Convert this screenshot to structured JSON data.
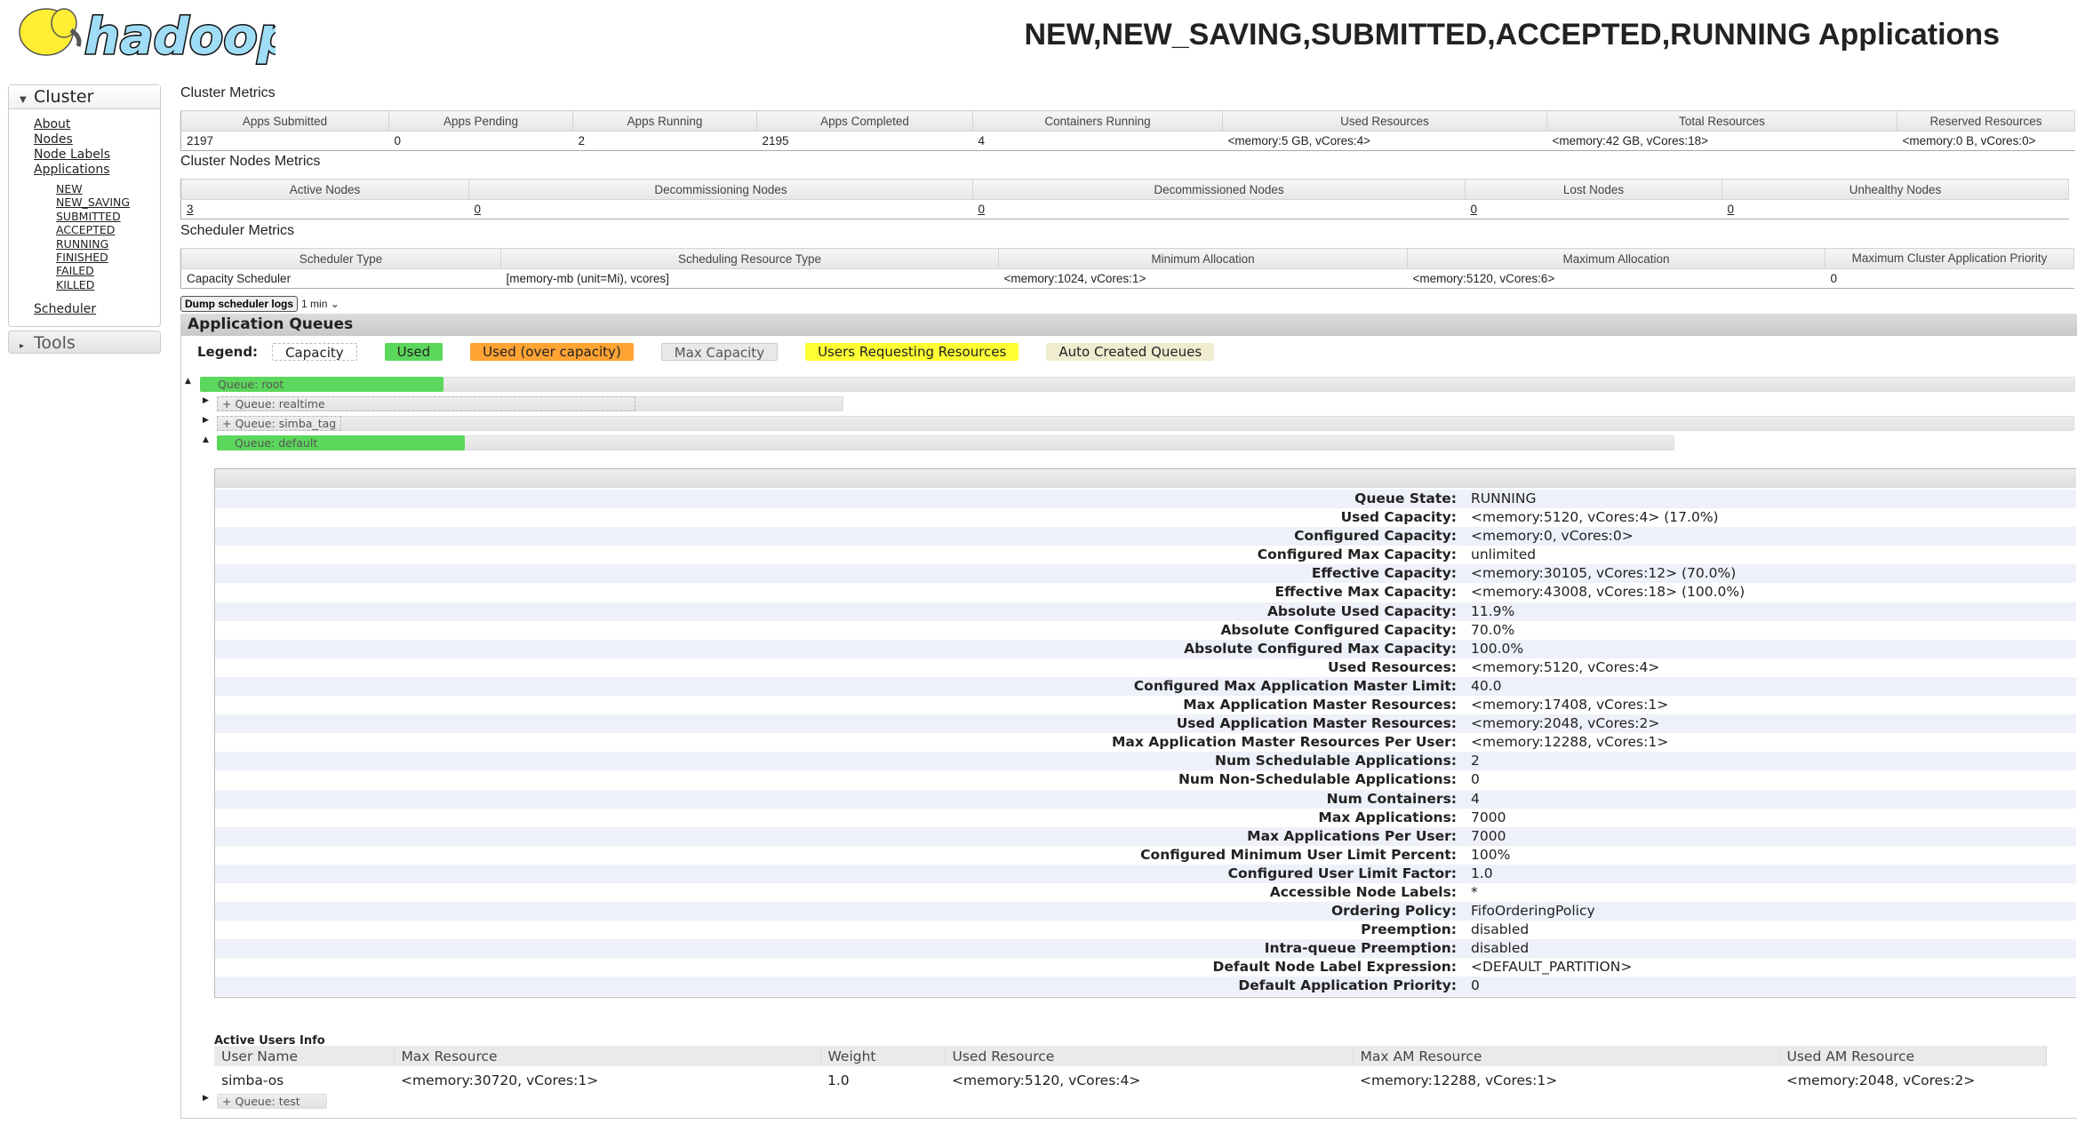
{
  "header": {
    "logo_text": "hadoop",
    "title": "NEW,NEW_SAVING,SUBMITTED,ACCEPTED,RUNNING Applications"
  },
  "sidebar": {
    "cluster_label": "Cluster",
    "links": [
      "About",
      "Nodes",
      "Node Labels",
      "Applications"
    ],
    "app_states": [
      "NEW",
      "NEW_SAVING",
      "SUBMITTED",
      "ACCEPTED",
      "RUNNING",
      "FINISHED",
      "FAILED",
      "KILLED"
    ],
    "scheduler": "Scheduler",
    "tools_label": "Tools"
  },
  "cluster_metrics": {
    "title": "Cluster Metrics",
    "headers": [
      "Apps Submitted",
      "Apps Pending",
      "Apps Running",
      "Apps Completed",
      "Containers Running",
      "Used Resources",
      "Total Resources",
      "Reserved Resources"
    ],
    "values": [
      "2197",
      "0",
      "2",
      "2195",
      "4",
      "<memory:5 GB, vCores:4>",
      "<memory:42 GB, vCores:18>",
      "<memory:0 B, vCores:0>"
    ]
  },
  "nodes_metrics": {
    "title": "Cluster Nodes Metrics",
    "headers": [
      "Active Nodes",
      "Decommissioning Nodes",
      "Decommissioned Nodes",
      "Lost Nodes",
      "Unhealthy Nodes"
    ],
    "values": [
      "3",
      "0",
      "0",
      "0",
      "0"
    ]
  },
  "scheduler_metrics": {
    "title": "Scheduler Metrics",
    "headers": [
      "Scheduler Type",
      "Scheduling Resource Type",
      "Minimum Allocation",
      "Maximum Allocation",
      "Maximum Cluster Application Priority"
    ],
    "values": [
      "Capacity Scheduler",
      "[memory-mb (unit=Mi), vcores]",
      "<memory:1024, vCores:1>",
      "<memory:5120, vCores:6>",
      "0"
    ]
  },
  "dump": {
    "button": "Dump scheduler logs",
    "interval": "1 min"
  },
  "queues": {
    "title": "Application Queues",
    "legend_label": "Legend:",
    "legend": [
      {
        "label": "Capacity",
        "color": "#ffffff"
      },
      {
        "label": "Used",
        "color": "#5bd75b"
      },
      {
        "label": "Used (over capacity)",
        "color": "#ffa333"
      },
      {
        "label": "Max Capacity",
        "color": "#e8e8e8"
      },
      {
        "label": "Users Requesting Resources",
        "color": "#ffff33"
      },
      {
        "label": "Auto Created Queues",
        "color": "#f0ecd0"
      }
    ],
    "items": {
      "root": "Queue: root",
      "realtime": "+ Queue: realtime",
      "simba_tag": "+ Queue: simba_tag",
      "default": "Queue: default",
      "test": "+ Queue: test"
    },
    "root_used_pct": 13,
    "default_used_pct": 17
  },
  "default_details": [
    [
      "Queue State:",
      "RUNNING"
    ],
    [
      "Used Capacity:",
      "<memory:5120, vCores:4> (17.0%)"
    ],
    [
      "Configured Capacity:",
      "<memory:0, vCores:0>"
    ],
    [
      "Configured Max Capacity:",
      "unlimited"
    ],
    [
      "Effective Capacity:",
      "<memory:30105, vCores:12> (70.0%)"
    ],
    [
      "Effective Max Capacity:",
      "<memory:43008, vCores:18> (100.0%)"
    ],
    [
      "Absolute Used Capacity:",
      "11.9%"
    ],
    [
      "Absolute Configured Capacity:",
      "70.0%"
    ],
    [
      "Absolute Configured Max Capacity:",
      "100.0%"
    ],
    [
      "Used Resources:",
      "<memory:5120, vCores:4>"
    ],
    [
      "Configured Max Application Master Limit:",
      "40.0"
    ],
    [
      "Max Application Master Resources:",
      "<memory:17408, vCores:1>"
    ],
    [
      "Used Application Master Resources:",
      "<memory:2048, vCores:2>"
    ],
    [
      "Max Application Master Resources Per User:",
      "<memory:12288, vCores:1>"
    ],
    [
      "Num Schedulable Applications:",
      "2"
    ],
    [
      "Num Non-Schedulable Applications:",
      "0"
    ],
    [
      "Num Containers:",
      "4"
    ],
    [
      "Max Applications:",
      "7000"
    ],
    [
      "Max Applications Per User:",
      "7000"
    ],
    [
      "Configured Minimum User Limit Percent:",
      "100%"
    ],
    [
      "Configured User Limit Factor:",
      "1.0"
    ],
    [
      "Accessible Node Labels:",
      "*"
    ],
    [
      "Ordering Policy:",
      "FifoOrderingPolicy"
    ],
    [
      "Preemption:",
      "disabled"
    ],
    [
      "Intra-queue Preemption:",
      "disabled"
    ],
    [
      "Default Node Label Expression:",
      "<DEFAULT_PARTITION>"
    ],
    [
      "Default Application Priority:",
      "0"
    ]
  ],
  "active_users": {
    "title": "Active Users Info",
    "headers": [
      "User Name",
      "Max Resource",
      "Weight",
      "Used Resource",
      "Max AM Resource",
      "Used AM Resource"
    ],
    "rows": [
      [
        "simba-os",
        "<memory:30720, vCores:1>",
        "1.0",
        "<memory:5120, vCores:4>",
        "<memory:12288, vCores:1>",
        "<memory:2048, vCores:2>"
      ]
    ]
  }
}
